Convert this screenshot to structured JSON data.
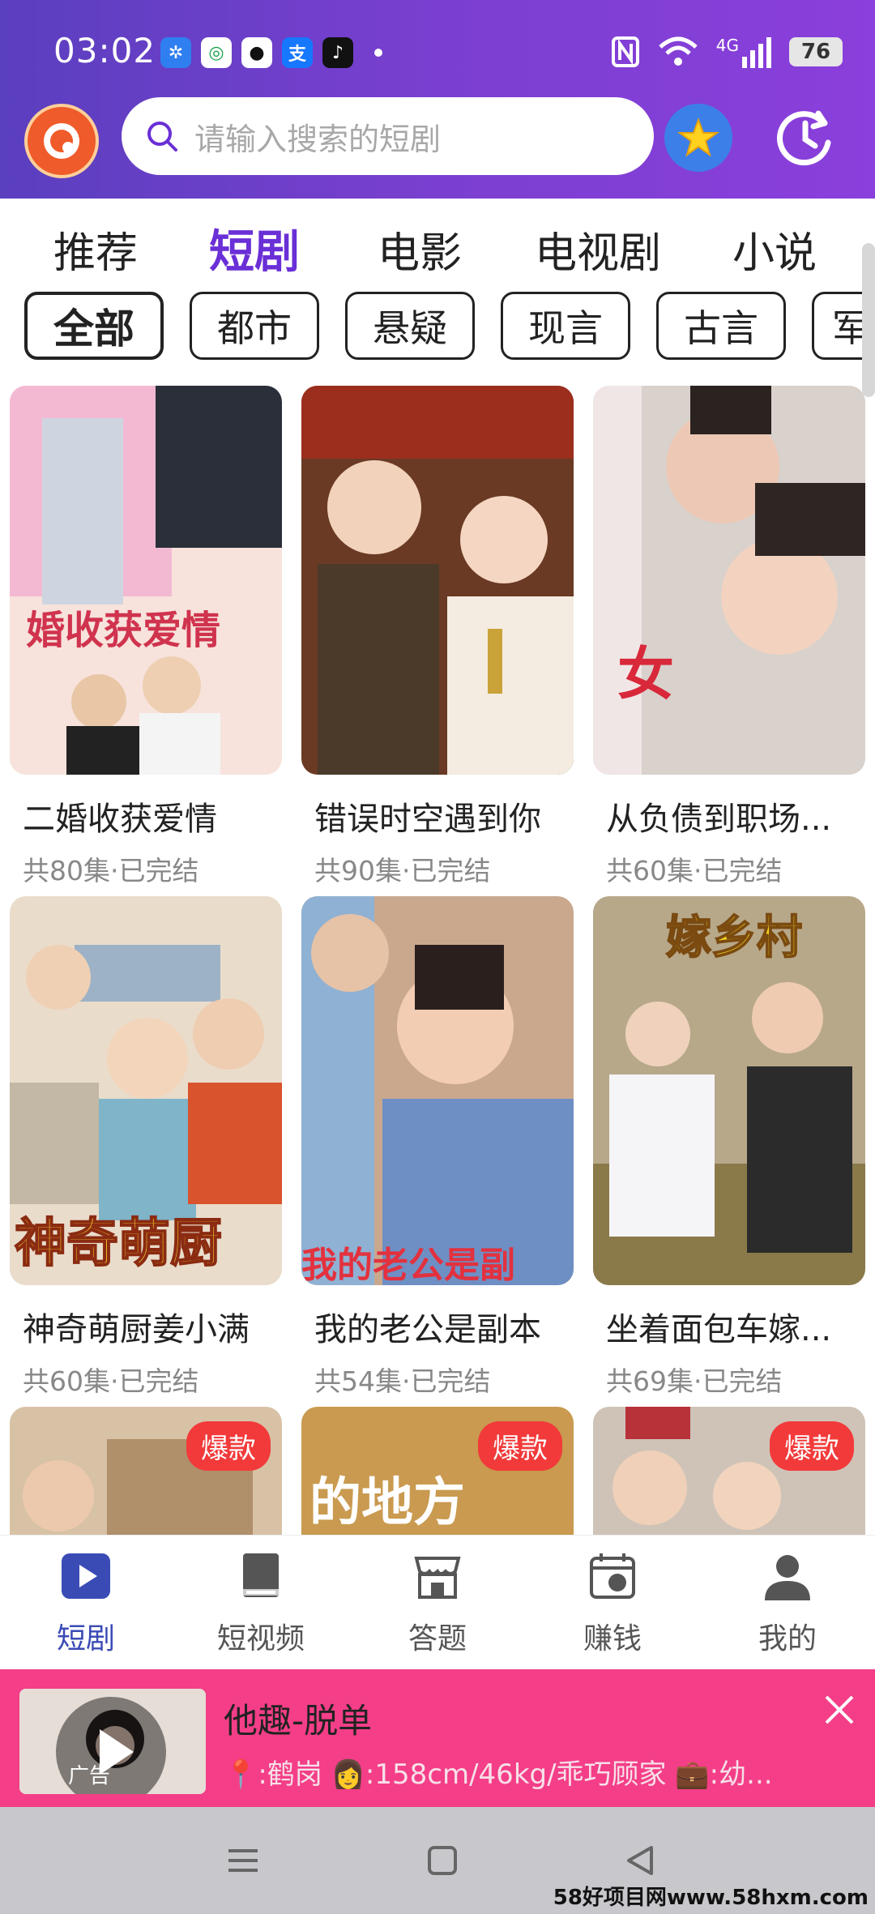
{
  "status_bar": {
    "time": "03:02",
    "apps": [
      "pinwheel-app",
      "mobile-app",
      "qq-app",
      "alipay-app",
      "tiktok-app"
    ],
    "network": "4G",
    "battery": "76"
  },
  "header": {
    "search_placeholder": "请输入搜索的短剧"
  },
  "tabs": [
    "推荐",
    "短剧",
    "电影",
    "电视剧",
    "小说"
  ],
  "active_tab": "短剧",
  "chips": [
    "全部",
    "都市",
    "悬疑",
    "现言",
    "古言",
    "军"
  ],
  "cards": [
    {
      "title": "二婚收获爱情",
      "meta": "共80集·已完结",
      "poster_text": "婚收获爱情"
    },
    {
      "title": "错误时空遇到你",
      "meta": "共90集·已完结",
      "poster_text": ""
    },
    {
      "title": "从负债到职场...",
      "meta": "共60集·已完结",
      "poster_text": "女"
    },
    {
      "title": "神奇萌厨姜小满",
      "meta": "共60集·已完结",
      "poster_text": "神奇萌厨"
    },
    {
      "title": "我的老公是副本",
      "meta": "共54集·已完结",
      "poster_text": "我的老公是副"
    },
    {
      "title": "坐着面包车嫁...",
      "meta": "共69集·已完结",
      "poster_text": "嫁乡村"
    }
  ],
  "row3": [
    {
      "badge": "爆款",
      "poster_text": ""
    },
    {
      "badge": "爆款",
      "poster_text": "的地方"
    },
    {
      "badge": "爆款",
      "poster_text": ""
    }
  ],
  "bottom_nav": [
    {
      "label": "短剧",
      "icon": "play-icon",
      "active": true
    },
    {
      "label": "短视频",
      "icon": "book-icon",
      "active": false
    },
    {
      "label": "答题",
      "icon": "shop-icon",
      "active": false
    },
    {
      "label": "赚钱",
      "icon": "calendar-coin-icon",
      "active": false
    },
    {
      "label": "我的",
      "icon": "user-icon",
      "active": false
    }
  ],
  "ad": {
    "tag": "广告",
    "title": "他趣-脱单",
    "subtitle": "📍:鹤岗 👩:158cm/46kg/乖巧顾家 💼:幼..."
  },
  "watermark": "58好项目网www.58hxm.com",
  "colors": {
    "accent": "#6a2fd6",
    "nav_active": "#3b4bb5",
    "badge": "#f23a3a",
    "ad_bg": "#f43e88"
  }
}
